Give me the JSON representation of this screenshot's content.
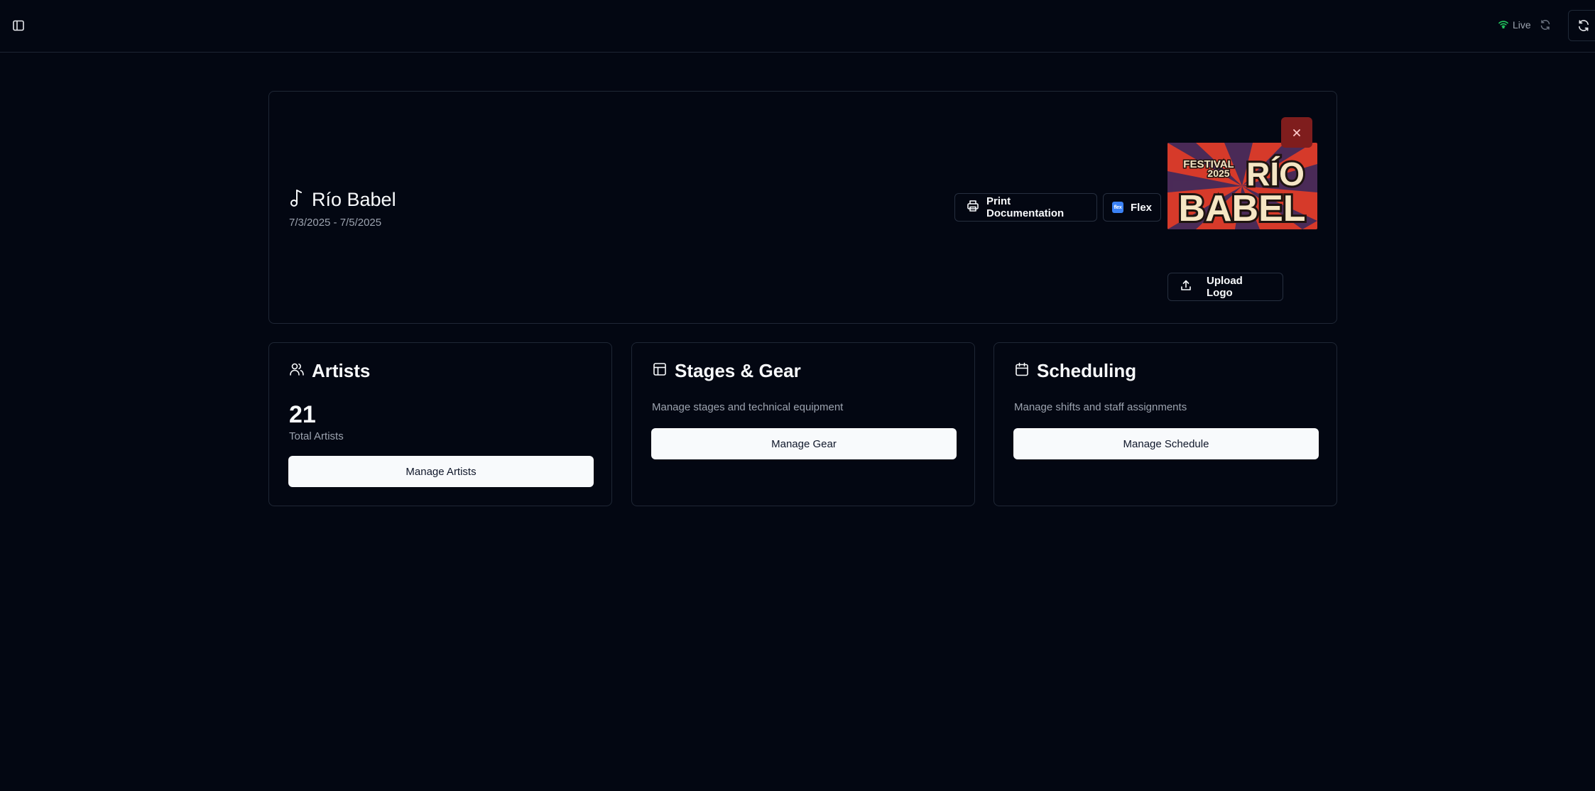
{
  "topbar": {
    "status_label": "Live",
    "icons": [
      "sidebar-toggle-icon",
      "wifi-icon",
      "refresh-icon"
    ]
  },
  "event": {
    "name": "Río Babel",
    "dates": "7/3/2025 - 7/5/2025",
    "print_label": "Print Documentation",
    "flex_label": "Flex",
    "upload_label": "Upload Logo",
    "logo": {
      "line1": "FESTIVAL",
      "line2": "2025",
      "line3": "RÍO",
      "line4": "BABEL"
    },
    "flex_badge": "flex"
  },
  "cards": {
    "artists": {
      "title": "Artists",
      "count": "21",
      "count_label": "Total Artists",
      "button": "Manage Artists"
    },
    "stages": {
      "title": "Stages & Gear",
      "description": "Manage stages and technical equipment",
      "button": "Manage Gear"
    },
    "scheduling": {
      "title": "Scheduling",
      "description": "Manage shifts and staff assignments",
      "button": "Manage Schedule"
    }
  },
  "colors": {
    "background": "#030712",
    "border": "#1f2735",
    "primary_button": "#f8fafc",
    "danger": "#7f1d1d",
    "live": "#22c55e"
  }
}
